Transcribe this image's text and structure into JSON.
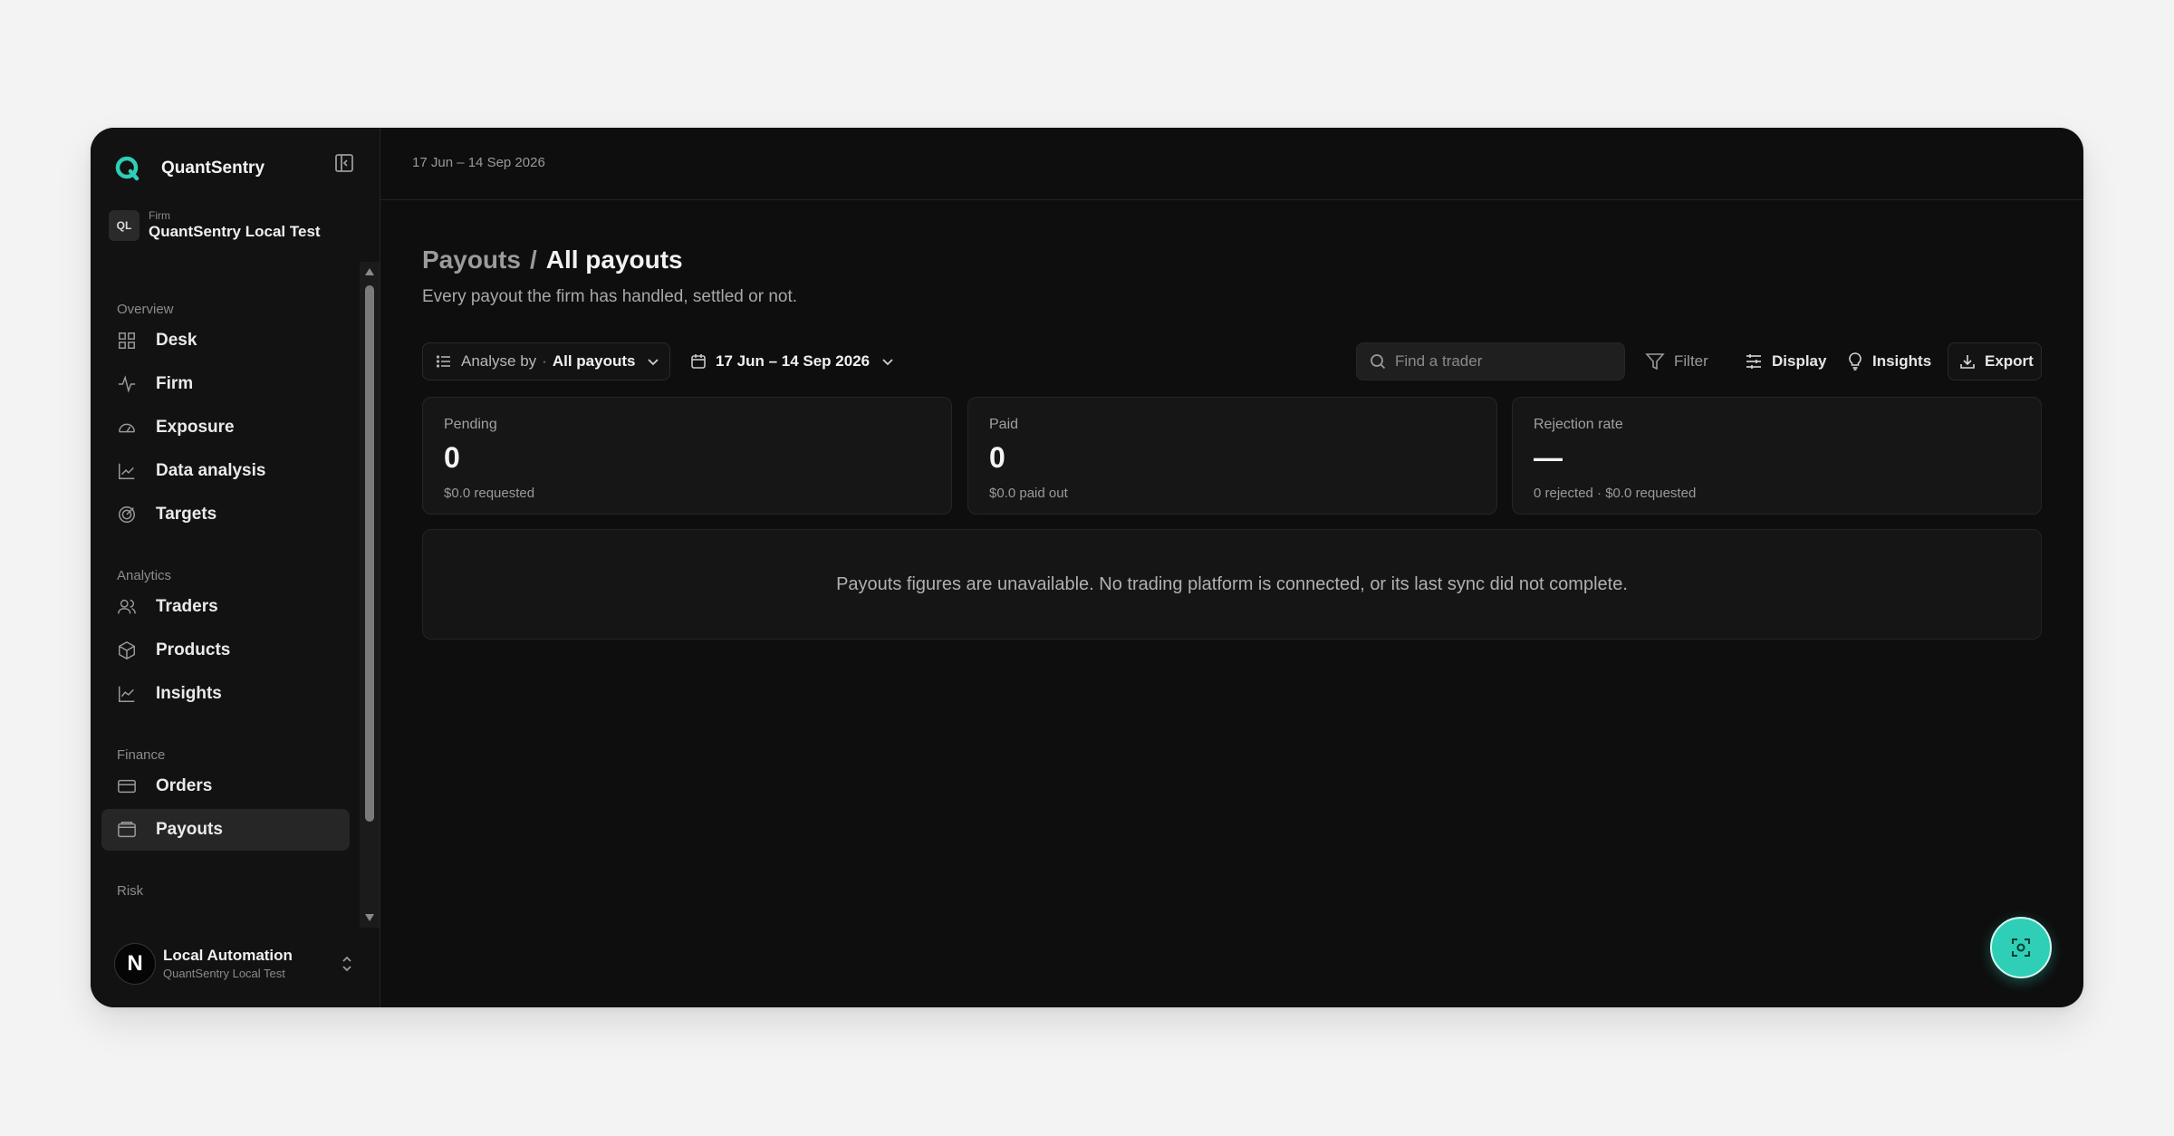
{
  "app": {
    "name": "QuantSentry"
  },
  "firm": {
    "badge": "QL",
    "label": "Firm",
    "name": "QuantSentry Local Test"
  },
  "nav": {
    "sections": [
      {
        "title": "Overview",
        "items": [
          {
            "label": "Desk",
            "icon": "grid-icon"
          },
          {
            "label": "Firm",
            "icon": "activity-icon"
          },
          {
            "label": "Exposure",
            "icon": "gauge-icon"
          },
          {
            "label": "Data analysis",
            "icon": "line-chart-icon"
          },
          {
            "label": "Targets",
            "icon": "target-icon"
          }
        ]
      },
      {
        "title": "Analytics",
        "items": [
          {
            "label": "Traders",
            "icon": "users-icon"
          },
          {
            "label": "Products",
            "icon": "package-icon"
          },
          {
            "label": "Insights",
            "icon": "trend-icon"
          }
        ]
      },
      {
        "title": "Finance",
        "items": [
          {
            "label": "Orders",
            "icon": "card-icon"
          },
          {
            "label": "Payouts",
            "icon": "wallet-icon",
            "active": true
          }
        ]
      },
      {
        "title": "Risk",
        "items": []
      }
    ]
  },
  "user": {
    "initial": "N",
    "name": "Local Automation",
    "org": "QuantSentry Local Test"
  },
  "topbar": {
    "date_range": "17 Jun – 14 Sep 2026"
  },
  "page": {
    "breadcrumb_parent": "Payouts",
    "breadcrumb_sep": "/",
    "title": "All payouts",
    "subtitle": "Every payout the firm has handled, settled or not."
  },
  "toolbar": {
    "analyse_label": "Analyse by",
    "analyse_dot": "·",
    "analyse_value": "All payouts",
    "date_value": "17 Jun – 14 Sep 2026",
    "search_placeholder": "Find a trader",
    "filter_label": "Filter",
    "display_label": "Display",
    "insights_label": "Insights",
    "export_label": "Export"
  },
  "cards": [
    {
      "label": "Pending",
      "value": "0",
      "sub": "$0.0 requested"
    },
    {
      "label": "Paid",
      "value": "0",
      "sub": "$0.0 paid out"
    },
    {
      "label": "Rejection rate",
      "value": "—",
      "sub": "0 rejected · $0.0 requested"
    }
  ],
  "notice": "Payouts figures are unavailable. No trading platform is connected, or its last sync did not complete.",
  "colors": {
    "accent": "#2ecfb6",
    "background": "#0e0e0e",
    "page": "#f3f3f3"
  }
}
